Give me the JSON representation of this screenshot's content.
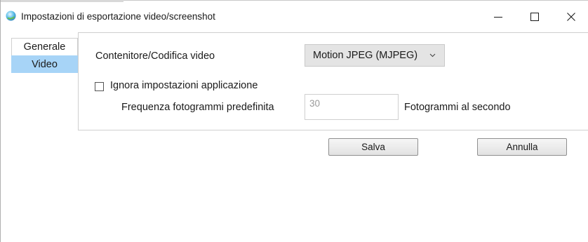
{
  "window": {
    "title": "Impostazioni di esportazione video/screenshot",
    "controls": {
      "minimize": "—",
      "maximize": "☐",
      "close": "✕"
    }
  },
  "tabs": [
    {
      "label": "Generale",
      "selected": false
    },
    {
      "label": "Video",
      "selected": true
    }
  ],
  "video": {
    "container_label": "Contenitore/Codifica video",
    "container_value": "Motion JPEG (MJPEG)",
    "ignore_app_settings_label": "Ignora impostazioni applicazione",
    "ignore_app_settings_checked": false,
    "framerate_label": "Frequenza fotogrammi predefinita",
    "framerate_value": "30",
    "framerate_unit": "Fotogrammi al secondo"
  },
  "buttons": {
    "save": "Salva",
    "cancel": "Annulla"
  },
  "colors": {
    "selected_tab": "#a7d4f7",
    "select_bg": "#e4e4e4",
    "app_icon": "#3aa0d8"
  },
  "icons": {
    "app": "globe-icon",
    "select": "chevron-down-icon"
  }
}
